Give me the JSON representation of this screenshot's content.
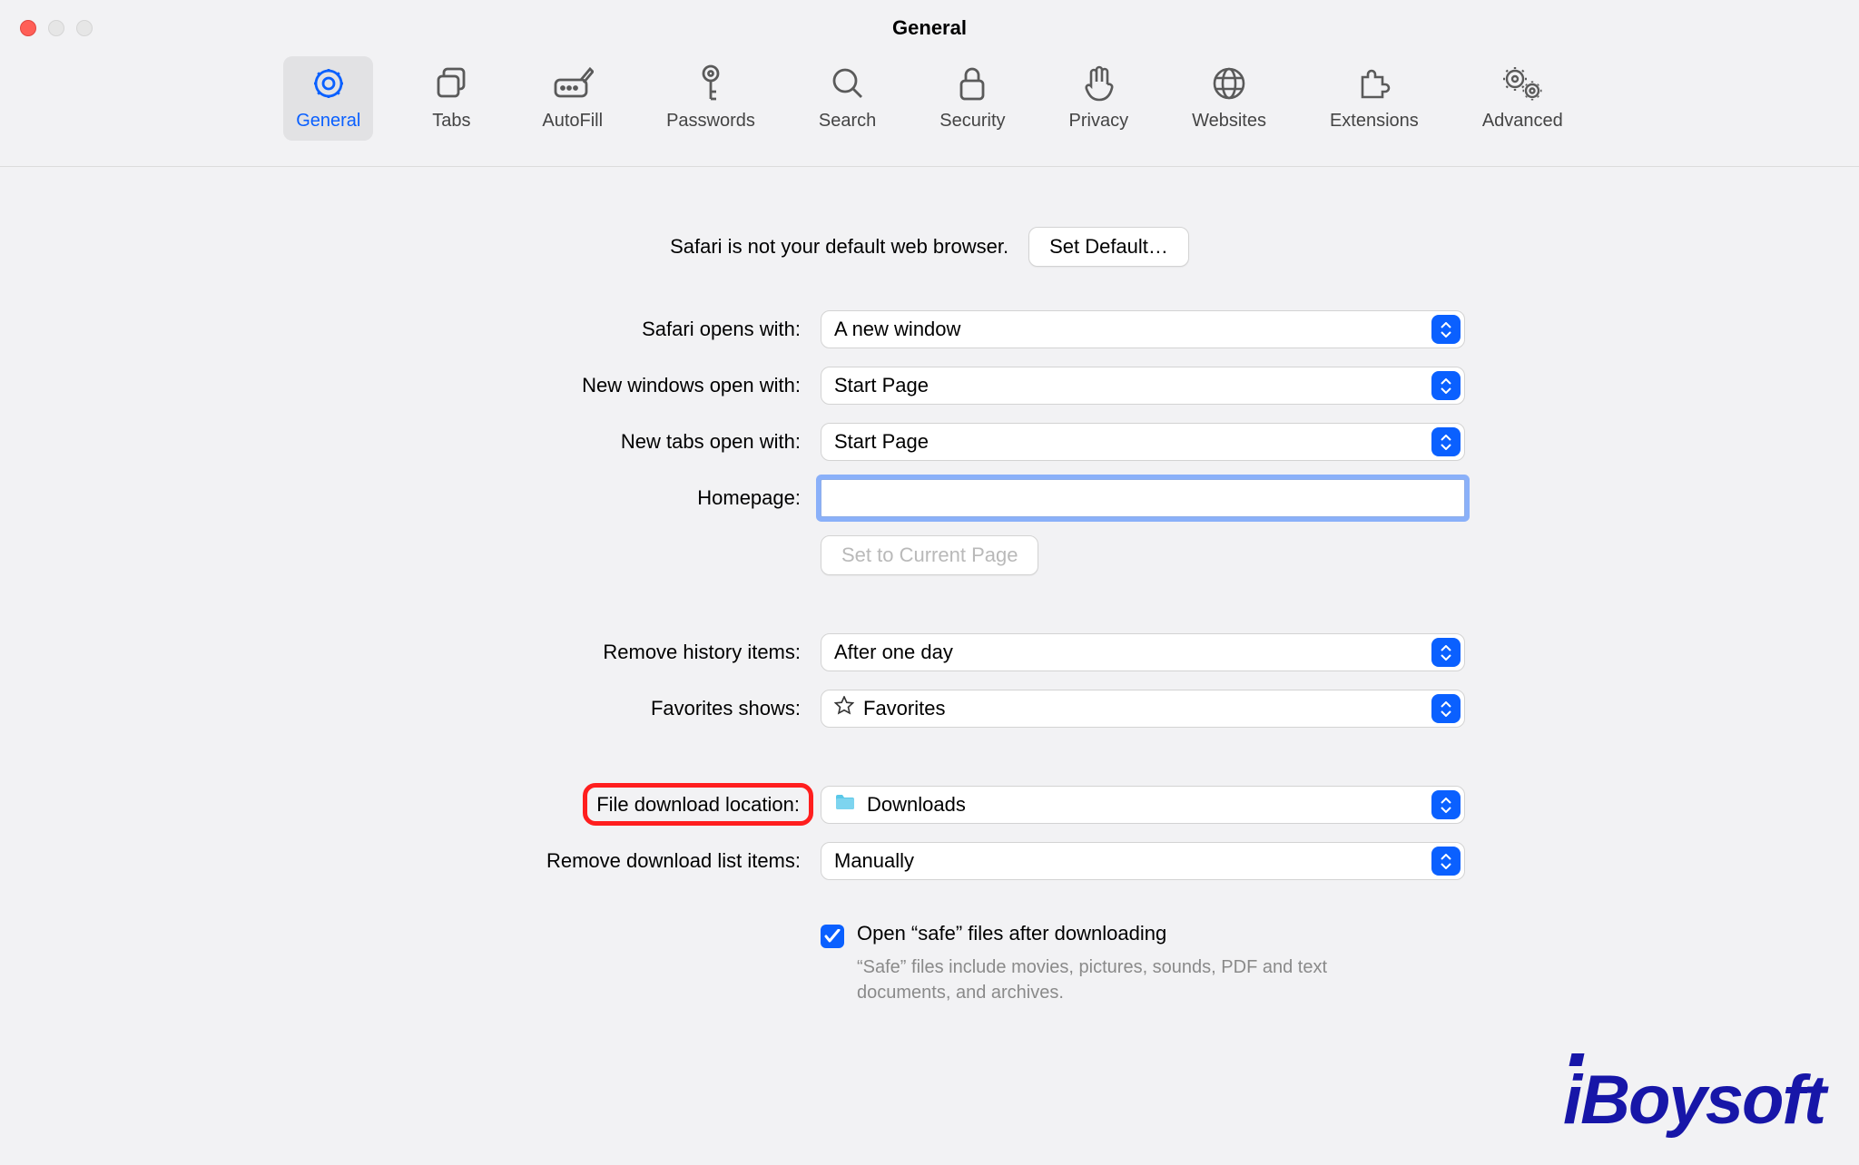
{
  "window": {
    "title": "General"
  },
  "toolbar": [
    {
      "id": "general-tab",
      "label": "General",
      "active": true
    },
    {
      "id": "tabs-tab",
      "label": "Tabs",
      "active": false
    },
    {
      "id": "autofill-tab",
      "label": "AutoFill",
      "active": false
    },
    {
      "id": "passwords-tab",
      "label": "Passwords",
      "active": false
    },
    {
      "id": "search-tab",
      "label": "Search",
      "active": false
    },
    {
      "id": "security-tab",
      "label": "Security",
      "active": false
    },
    {
      "id": "privacy-tab",
      "label": "Privacy",
      "active": false
    },
    {
      "id": "websites-tab",
      "label": "Websites",
      "active": false
    },
    {
      "id": "extensions-tab",
      "label": "Extensions",
      "active": false
    },
    {
      "id": "advanced-tab",
      "label": "Advanced",
      "active": false
    }
  ],
  "defaultBrowser": {
    "message": "Safari is not your default web browser.",
    "button": "Set Default…"
  },
  "settings": {
    "opensWith": {
      "label": "Safari opens with:",
      "value": "A new window"
    },
    "newWindows": {
      "label": "New windows open with:",
      "value": "Start Page"
    },
    "newTabs": {
      "label": "New tabs open with:",
      "value": "Start Page"
    },
    "homepage": {
      "label": "Homepage:",
      "value": ""
    },
    "setCurrent": {
      "label": "Set to Current Page"
    },
    "historyRemove": {
      "label": "Remove history items:",
      "value": "After one day"
    },
    "favorites": {
      "label": "Favorites shows:",
      "value": "Favorites"
    },
    "downloadLocation": {
      "label": "File download location:",
      "value": "Downloads"
    },
    "downloadListRemove": {
      "label": "Remove download list items:",
      "value": "Manually"
    },
    "openSafe": {
      "checked": true,
      "label": "Open “safe” files after downloading",
      "note": "“Safe” files include movies, pictures, sounds, PDF and text documents, and archives."
    }
  },
  "watermark": "iBoysoft"
}
